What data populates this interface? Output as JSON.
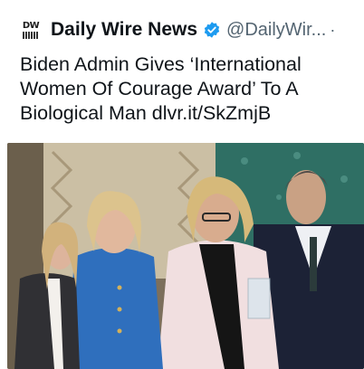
{
  "post": {
    "author_name": "Daily Wire News",
    "author_handle": "@DailyWir...",
    "logo_text": "DW",
    "more_label": "·",
    "text": "Biden Admin Gives ‘International Women Of Courage Award’ To A Biological Man dlvr.it/SkZmjB"
  },
  "colors": {
    "verified_badge": "#1d9bf0",
    "text_primary": "#0f1419",
    "text_secondary": "#536471"
  }
}
